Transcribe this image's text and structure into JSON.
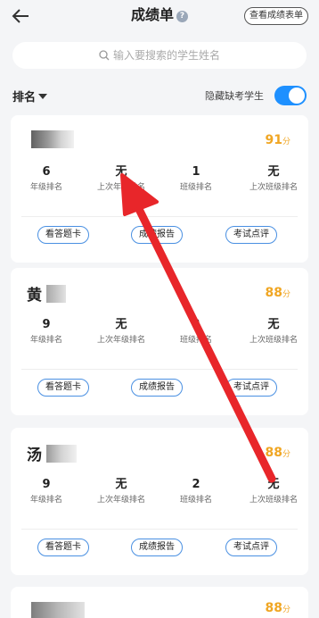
{
  "header": {
    "title": "成绩单",
    "help_glyph": "?",
    "view_sheet_label": "查看成绩表单"
  },
  "search": {
    "placeholder": "输入要搜索的学生姓名"
  },
  "sort": {
    "label": "排名"
  },
  "hide_absent": {
    "label": "隐藏缺考学生",
    "enabled": true
  },
  "colors": {
    "accent": "#1e90ff",
    "score": "#f0a623",
    "annotation_arrow": "#e8262a"
  },
  "students": [
    {
      "name": "",
      "score": "91",
      "score_unit": "分",
      "stats": [
        {
          "value": "6",
          "label": "年级排名"
        },
        {
          "value": "无",
          "label": "上次年级排名"
        },
        {
          "value": "1",
          "label": "班级排名"
        },
        {
          "value": "无",
          "label": "上次班级排名"
        }
      ],
      "actions": [
        "看答题卡",
        "成绩报告",
        "考试点评"
      ]
    },
    {
      "name": "黄",
      "score": "88",
      "score_unit": "分",
      "stats": [
        {
          "value": "9",
          "label": "年级排名"
        },
        {
          "value": "无",
          "label": "上次年级排名"
        },
        {
          "value": "2",
          "label": "班级排名"
        },
        {
          "value": "无",
          "label": "上次班级排名"
        }
      ],
      "actions": [
        "看答题卡",
        "成绩报告",
        "考试点评"
      ]
    },
    {
      "name": "汤",
      "score": "88",
      "score_unit": "分",
      "stats": [
        {
          "value": "9",
          "label": "年级排名"
        },
        {
          "value": "无",
          "label": "上次年级排名"
        },
        {
          "value": "2",
          "label": "班级排名"
        },
        {
          "value": "无",
          "label": "上次班级排名"
        }
      ],
      "actions": [
        "看答题卡",
        "成绩报告",
        "考试点评"
      ]
    },
    {
      "name": "",
      "score": "88",
      "score_unit": "分"
    }
  ]
}
